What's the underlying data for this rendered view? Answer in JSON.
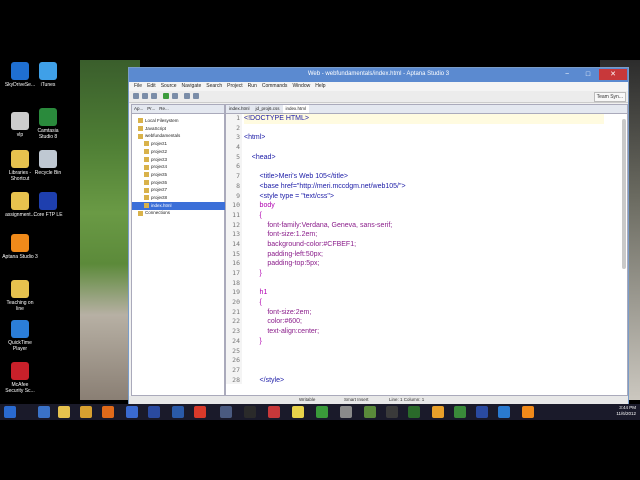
{
  "desktop": {
    "icons": [
      {
        "label": "SkyDriveSe...",
        "color": "#1f6fd1"
      },
      {
        "label": "iTunes",
        "color": "#3fa0e8"
      },
      {
        "label": "vlp",
        "color": "#cccccc"
      },
      {
        "label": "Camtasia Studio 8",
        "color": "#2a8a3c"
      },
      {
        "label": "Libraries - Shortcut",
        "color": "#e7c24e"
      },
      {
        "label": "Recycle Bin",
        "color": "#bfc8d2"
      },
      {
        "label": "assignment...",
        "color": "#e7c24e"
      },
      {
        "label": "Core FTP LE",
        "color": "#1e3fae"
      },
      {
        "label": "Aptana Studio 3",
        "color": "#f08a1a"
      },
      {
        "label": "Teaching on line",
        "color": "#e7c24e"
      },
      {
        "label": "QuickTime Player",
        "color": "#2b7ed9"
      },
      {
        "label": "McAfee Security Sc...",
        "color": "#c8202a"
      }
    ]
  },
  "window": {
    "title": "Web - webfundamentals/index.html - Aptana Studio 3",
    "controls": {
      "minimize": "−",
      "maximize": "□",
      "close": "✕"
    },
    "menu": [
      "File",
      "Edit",
      "Source",
      "Navigate",
      "Search",
      "Project",
      "Run",
      "Commands",
      "Window",
      "Help"
    ],
    "perspective_label": "Team Syn..."
  },
  "left_panel": {
    "tabs": [
      "Ap...",
      "Pr...",
      "Re..."
    ],
    "tree": [
      {
        "label": "Local Filesystem",
        "indent": 1
      },
      {
        "label": "JavaScript",
        "indent": 1
      },
      {
        "label": "webfundamentals",
        "indent": 1
      },
      {
        "label": "project1",
        "indent": 2
      },
      {
        "label": "project2",
        "indent": 2
      },
      {
        "label": "project3",
        "indent": 2
      },
      {
        "label": "project4",
        "indent": 2
      },
      {
        "label": "project5",
        "indent": 2
      },
      {
        "label": "project6",
        "indent": 2
      },
      {
        "label": "project7",
        "indent": 2
      },
      {
        "label": "project8",
        "indent": 2
      },
      {
        "label": "index.html",
        "indent": 2,
        "selected": true
      },
      {
        "label": "Connections",
        "indent": 1
      }
    ]
  },
  "editor": {
    "tabs": [
      "index.html",
      "jd_proj6.css",
      "index.html"
    ],
    "active_tab": 2,
    "line_numbers": [
      "1",
      "2",
      "3",
      "4",
      "5",
      "6",
      "7",
      "8",
      "9",
      "10",
      "11",
      "12",
      "13",
      "14",
      "15",
      "16",
      "17",
      "18",
      "19",
      "20",
      "21",
      "22",
      "23",
      "24",
      "25",
      "26",
      "27",
      "28"
    ],
    "code_lines": [
      "<!DOCTYPE HTML>",
      "",
      "<html>",
      "",
      "    <head>",
      "",
      "        <title>Meri's Web 105</title>",
      "        <base href=\"http://meri.mccdgm.net/web105/\">",
      "        <style type = \"text/css\">",
      "        body",
      "        {",
      "            font-family:Verdana, Geneva, sans-serif;",
      "            font-size:1.2em;",
      "            background-color:#CFBEF1;",
      "            padding-left:50px;",
      "            padding-top:5px;",
      "        }",
      "",
      "        h1",
      "        {",
      "            font-size:2em;",
      "            color:#600;",
      "            text-align:center;",
      "        }",
      "",
      "",
      "",
      "        </style>"
    ],
    "colors": {
      "tag": "#1a1aa6",
      "selector": "#b000b0",
      "property": "#8a1c8a",
      "value": "#2a7a2a",
      "plain": "#222222"
    }
  },
  "status_bar": {
    "writable": "Writable",
    "insert_mode": "Smart Insert",
    "position": "Line: 1 Column: 1"
  },
  "taskbar": {
    "time": "3:44 PM",
    "date": "11/6/2012"
  }
}
